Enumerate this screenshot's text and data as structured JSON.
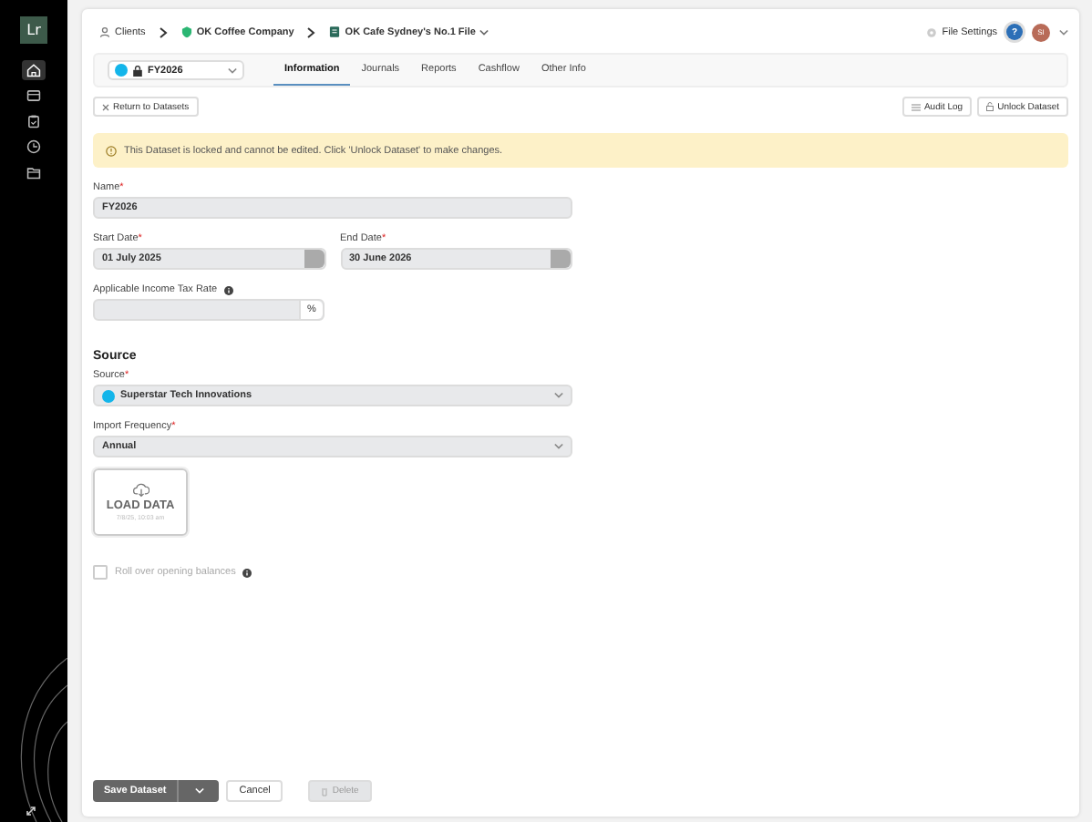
{
  "sidebar": {
    "logo": "Lr",
    "items": [
      {
        "selected": true
      },
      {
        "selected": false
      },
      {
        "selected": false
      },
      {
        "selected": false
      },
      {
        "selected": false
      }
    ]
  },
  "breadcrumbs": [
    {
      "kind": "people",
      "label": "Clients"
    },
    {
      "kind": "shield",
      "label": "OK Coffee Company"
    },
    {
      "kind": "file",
      "label": "OK Cafe Sydney's No.1 File"
    }
  ],
  "header": {
    "settings": "File Settings",
    "help": "?",
    "avatar": "SI"
  },
  "dataset_select": {
    "value": "FY2026",
    "locked": true
  },
  "tabs": [
    {
      "label": "Information",
      "selected": true
    },
    {
      "label": "Journals",
      "selected": false
    },
    {
      "label": "Reports",
      "selected": false
    },
    {
      "label": "Cashflow",
      "selected": false
    },
    {
      "label": "Other Info",
      "selected": false
    }
  ],
  "toolbar": {
    "back": "Return to Datasets",
    "audit": "Audit Log",
    "unlock": "Unlock Dataset"
  },
  "banner": "This Dataset is locked and cannot be edited. Click 'Unlock Dataset' to make changes.",
  "form": {
    "name": {
      "label": "Name",
      "required_mark": "*",
      "value": "FY2026"
    },
    "start": {
      "label": "Start Date",
      "required_mark": "*",
      "value": "01 July 2025"
    },
    "end": {
      "label": "End Date",
      "required_mark": "*",
      "value": "30 June 2026"
    },
    "tax": {
      "label": "Applicable Income Tax Rate",
      "suffix": "%"
    },
    "section": "Source",
    "source": {
      "label": "Source",
      "required_mark": "*",
      "value": "Superstar Tech Innovations"
    },
    "frequency": {
      "label": "Import Frequency",
      "required_mark": "*",
      "value": "Annual"
    },
    "load": {
      "title": "LOAD DATA",
      "time": "7/8/25, 10:03 am"
    },
    "rollover": {
      "label": "Roll over opening balances",
      "checked": false
    }
  },
  "buttons": {
    "save": "Save Dataset",
    "cancel": "Cancel",
    "delete": "Delete"
  }
}
